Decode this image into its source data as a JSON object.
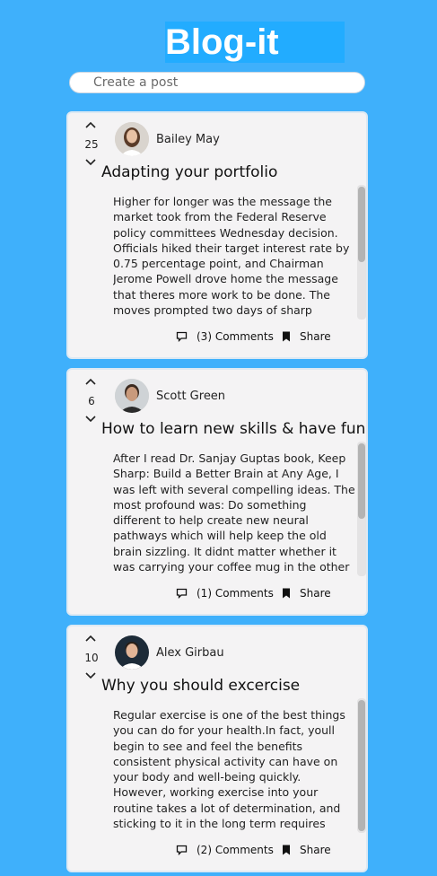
{
  "header": {
    "title": "Blog-it"
  },
  "create_post": {
    "placeholder": "Create a post"
  },
  "posts": [
    {
      "votes": "25",
      "author": "Bailey May",
      "title": "Adapting your portfolio",
      "body": "Higher for longer was the message the market took from the Federal Reserve policy committees Wednesday decision. Officials hiked their target interest rate by 0.75 percentage point, and Chairman Jerome Powell drove home the message that theres more work to be done. The moves prompted two days of sharp",
      "comments": "(3) Comments",
      "share": "Share"
    },
    {
      "votes": "6",
      "author": "Scott Green",
      "title": "How to learn new skills & have fun",
      "body": "After I read Dr. Sanjay Guptas book, Keep Sharp: Build a Better Brain at Any Age, I was left with several compelling ideas. The most profound was: Do something different to help create new neural pathways which will help keep the old brain sizzling. It didnt matter whether it was carrying your coffee mug in the other",
      "comments": "(1) Comments",
      "share": "Share"
    },
    {
      "votes": "10",
      "author": "Alex Girbau",
      "title": "Why you should excercise",
      "body": "Regular exercise is one of the best things you can do for your health.In fact, youll begin to see and feel the benefits consistent physical activity can have on your body and well-being quickly. However, working exercise into your routine takes a lot of determination, and sticking to it in the long term requires discipline.",
      "comments": "(2) Comments",
      "share": "Share"
    }
  ],
  "colors": {
    "page_background": "#3fb0fb",
    "header_background": "#22acff",
    "card_background": "#f4f3f4"
  }
}
